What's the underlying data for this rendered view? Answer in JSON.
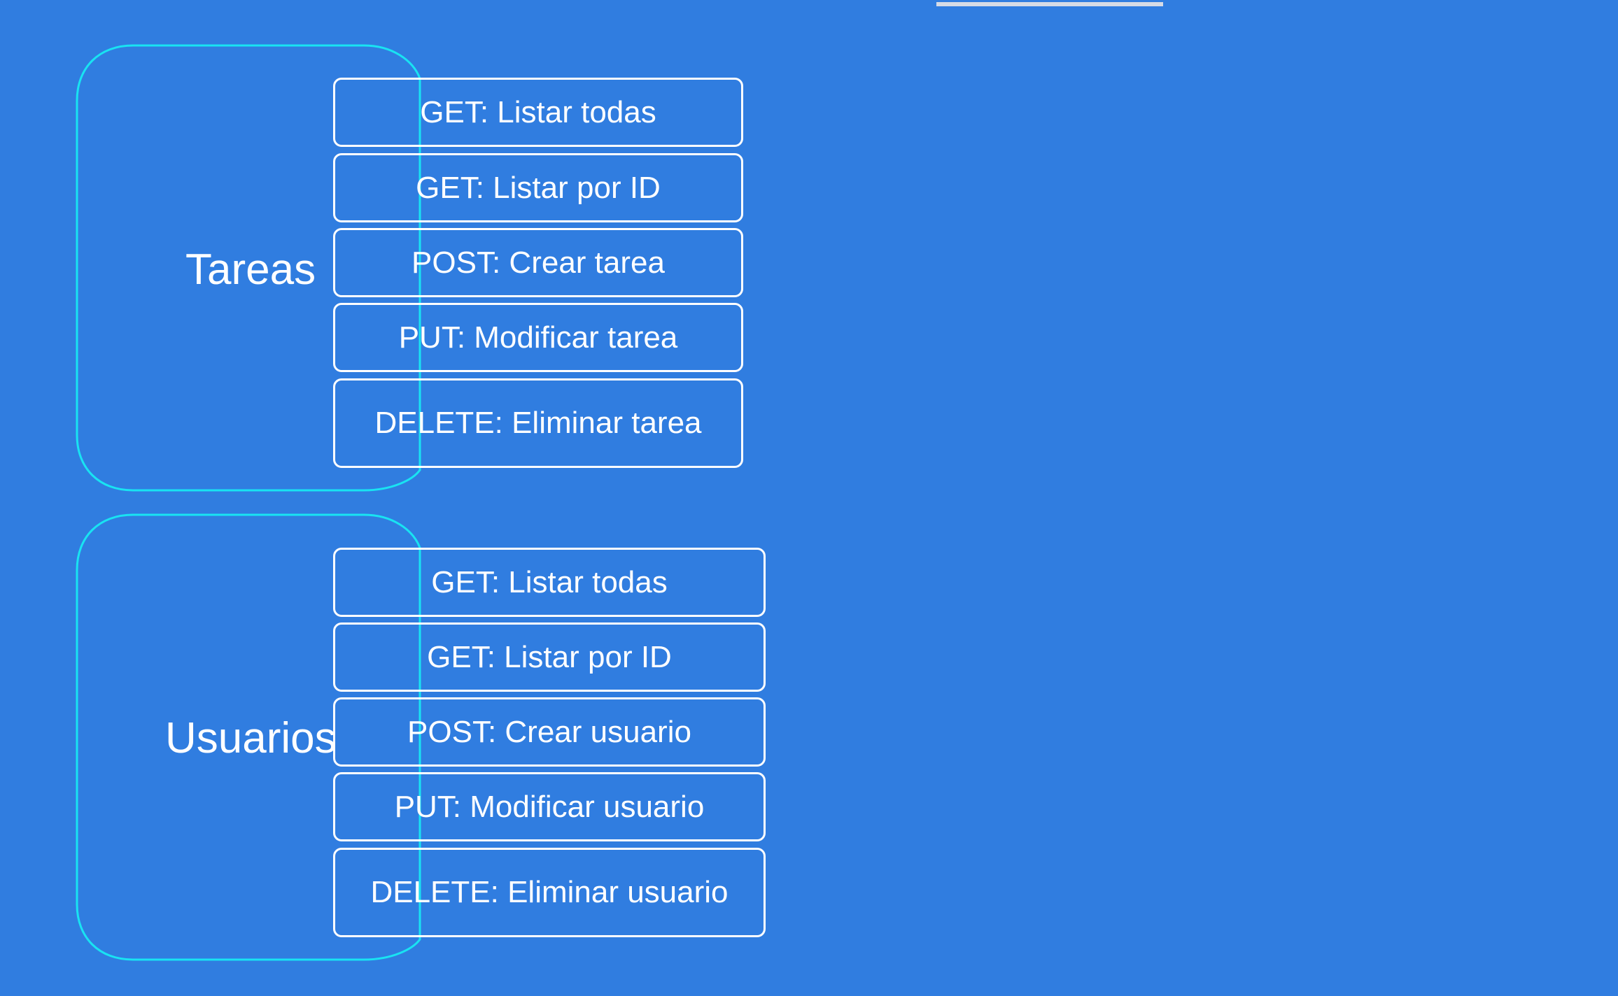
{
  "colors": {
    "background": "#307de0",
    "group_frame": "#19e3f2",
    "endpoint_border": "#ffffff",
    "text": "#ffffff",
    "top_bar": "#d6dbe6"
  },
  "groups": [
    {
      "title": "Tareas",
      "endpoints": [
        "GET: Listar todas",
        "GET: Listar por ID",
        "POST: Crear tarea",
        "PUT: Modificar tarea",
        "DELETE: Eliminar tarea"
      ]
    },
    {
      "title": "Usuarios",
      "endpoints": [
        "GET: Listar todas",
        "GET: Listar por ID",
        "POST: Crear usuario",
        "PUT: Modificar usuario",
        "DELETE: Eliminar usuario"
      ]
    }
  ]
}
